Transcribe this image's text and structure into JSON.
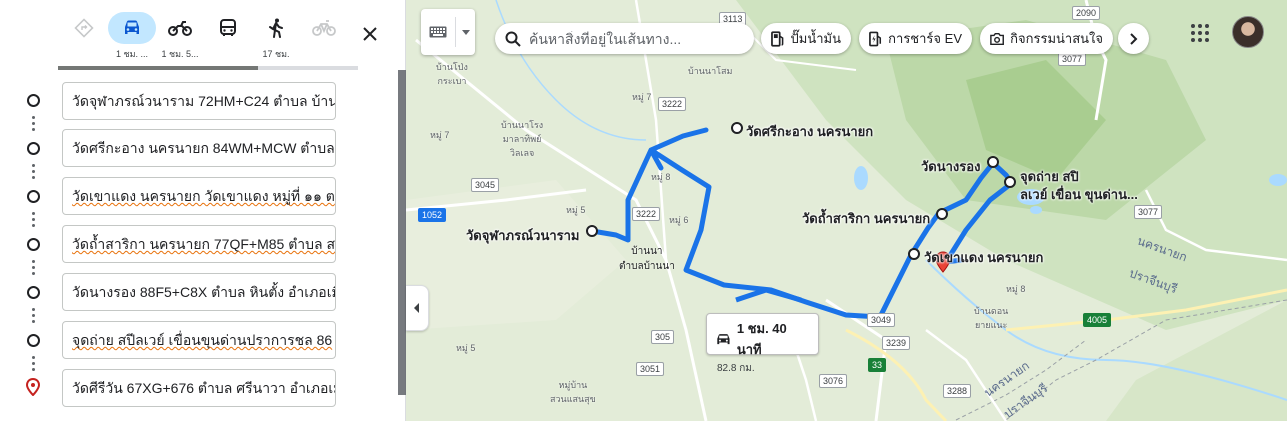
{
  "travel_modes": [
    {
      "icon": "best-route-icon",
      "time": ""
    },
    {
      "icon": "car-icon",
      "time": "1 ชม. ...",
      "active": true
    },
    {
      "icon": "motorcycle-icon",
      "time": "1 ชม. 5..."
    },
    {
      "icon": "transit-icon",
      "time": ""
    },
    {
      "icon": "walking-icon",
      "time": "17 ชม."
    },
    {
      "icon": "bicycle-icon",
      "time": ""
    }
  ],
  "stops": [
    {
      "text": "วัดจุฬาภรณ์วนาราม 72HM+C24 ตำบล บ้านพ",
      "flag": false
    },
    {
      "text": "วัดศรีกะอาง นครนายก 84WM+MCW ตำบล ห",
      "flag": false
    },
    {
      "text": "วัดเขาแดง นครนายก วัดเขาแดง หมู่ที่ ๑๑ ต",
      "flag": true
    },
    {
      "text": "วัดถ้ำสาริกา นครนายก 77QF+M85 ตำบล ส",
      "flag": true
    },
    {
      "text": "วัดนางรอง 88F5+C8X ตำบล หินตั้ง อำเภอเมื",
      "flag": false
    },
    {
      "text": "จุดถ่าย สปีลเวย์ เขื่อนขุนด่านปราการชล 86",
      "flag": true
    },
    {
      "text": "วัดศีรีวัน 67XG+676 ตำบล ศรีนาวา อำเภอเมื",
      "flag": false
    }
  ],
  "search": {
    "placeholder": "ค้นหาสิ่งที่อยู่ในเส้นทาง..."
  },
  "chips": [
    {
      "icon": "gas-station-icon",
      "label": "ปั๊มน้ำมัน"
    },
    {
      "icon": "ev-charging-icon",
      "label": "การชาร์จ EV"
    },
    {
      "icon": "camera-icon",
      "label": "กิจกรรมน่าสนใจ"
    }
  ],
  "route": {
    "duration": "1 ชม. 40 นาที",
    "distance": "82.8 กม."
  },
  "map_labels": {
    "wat_chulabhorn": "วัดจุฬาภรณ์วนาราม",
    "wat_sri_ka_ang": "วัดศรีกะอาง นครนายก",
    "wat_nang_rong": "วัดนางรอง",
    "spillway": "จุดถ่าย สปิ",
    "spillway_2": "ลเวย์ เขื่อน ขุนด่าน...",
    "wat_tham_sarika": "วัดถ้ำสาริกา นครนายก",
    "wat_khao_daeng": "วัดเขาแดง นครนายก",
    "nakhon_nayok": "นครนายก",
    "prachinburi": "ปราจีนบุรี",
    "nakhon_nayok_2": "นครนายก",
    "prachinburi_2": "ปราจีนบุรี",
    "ban_pong": "บ้านโป่ง\nกระเบา",
    "ban_na": "บ้านนา\nตำบลบ้านนา",
    "ban_na_school": "บ้านนาโรง\nมาลาทิพย์\nวิลเลจ",
    "moo7a": "หมู่ 7",
    "moo7b": "หมู่ 7",
    "moo8": "หมู่ 8",
    "moo5": "หมู่ 5",
    "moo6": "หมู่ 6",
    "moo5b": "หมู่ 5",
    "moo8b": "หมู่ 8",
    "ban_moo": "บ้านนาโสม",
    "ban_don": "บ้านดอน\nยายแนะ",
    "suan": "หมู่บ้าน\nสวนแสนสุข",
    "moo_top": "บ้านนาโสม"
  },
  "roads": [
    "3113",
    "2090",
    "3222",
    "3045",
    "1052",
    "3222",
    "3077",
    "3077",
    "305",
    "3051",
    "3076",
    "3239",
    "3049",
    "3288",
    "4005",
    "33"
  ]
}
